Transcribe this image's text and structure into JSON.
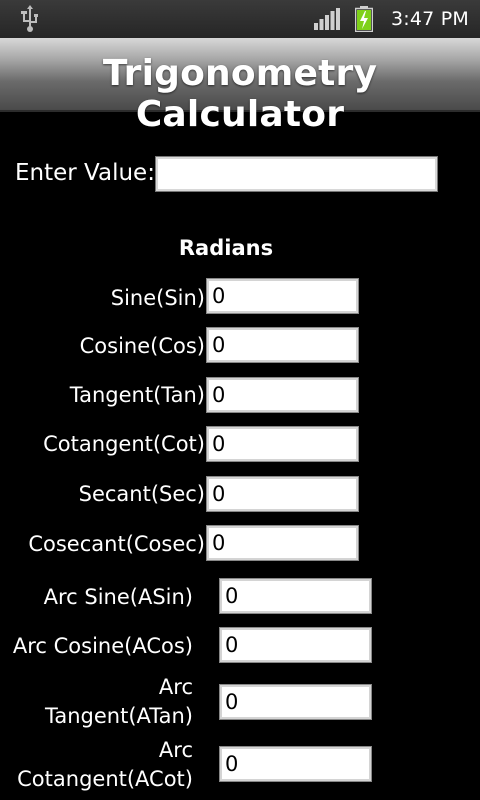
{
  "status_bar": {
    "time": "3:47 PM",
    "icons": [
      "usb-icon",
      "signal-icon",
      "battery-charging-icon"
    ],
    "battery_color": "#7fd11b"
  },
  "app": {
    "title": "Trigonometry Calculator"
  },
  "input": {
    "label": "Enter Value:",
    "value": ""
  },
  "section": {
    "title": "Radians"
  },
  "results": [
    {
      "label": "Sine(Sin)",
      "value": "0"
    },
    {
      "label": "Cosine(Cos)",
      "value": "0"
    },
    {
      "label": "Tangent(Tan)",
      "value": "0"
    },
    {
      "label": "Cotangent(Cot)",
      "value": "0"
    },
    {
      "label": "Secant(Sec)",
      "value": "0"
    },
    {
      "label": "Cosecant(Cosec)",
      "value": "0"
    },
    {
      "label": "Arc Sine(ASin)",
      "value": "0"
    },
    {
      "label": "Arc Cosine(ACos)",
      "value": "0"
    },
    {
      "label": "Arc\nTangent(ATan)",
      "value": "0"
    },
    {
      "label": "Arc\nCotangent(ACot)",
      "value": "0"
    }
  ]
}
